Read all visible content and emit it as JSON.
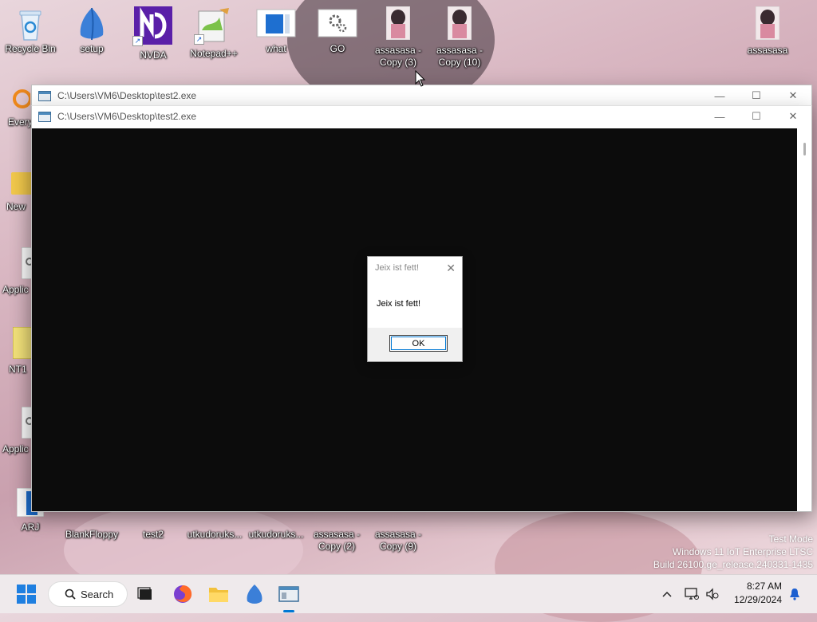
{
  "desktop": {
    "icons_top": [
      {
        "label": "Recycle Bin"
      },
      {
        "label": "setup"
      },
      {
        "label": "NVDA"
      },
      {
        "label": "Notepad++"
      },
      {
        "label": "what"
      },
      {
        "label": "GO"
      },
      {
        "label": "assasasa - Copy (3)"
      },
      {
        "label": "assasasa - Copy (10)"
      },
      {
        "label": "assasasa"
      }
    ],
    "icons_left": [
      {
        "label": "Every"
      },
      {
        "label": "New"
      },
      {
        "label": "Applic"
      },
      {
        "label": "NT1"
      },
      {
        "label": "Applic"
      }
    ],
    "icons_bottom": [
      {
        "label": "ARJ"
      },
      {
        "label": "BlankFloppy"
      },
      {
        "label": "test2"
      },
      {
        "label": "utkudoruks..."
      },
      {
        "label": "utkudoruks..."
      },
      {
        "label": "assasasa - Copy (2)"
      },
      {
        "label": "assasasa - Copy (9)"
      }
    ]
  },
  "windows": {
    "back_title": "C:\\Users\\VM6\\Desktop\\test2.exe",
    "front_title": "C:\\Users\\VM6\\Desktop\\test2.exe",
    "minimize_glyph": "—",
    "maximize_glyph": "☐",
    "close_glyph": "✕"
  },
  "dialog": {
    "title": "Jeix ist fett!",
    "message": "Jeix ist fett!",
    "ok_label": "OK",
    "close_glyph": "✕"
  },
  "watermark": {
    "line1": "Test Mode",
    "line2": "Windows 11 IoT Enterprise LTSC",
    "line3": "Build 26100.ge_release.240331-1435"
  },
  "taskbar": {
    "search_label": "Search",
    "time": "8:27 AM",
    "date": "12/29/2024",
    "chevron": "^"
  },
  "colors": {
    "console_bg": "#0c0c0c",
    "accent": "#0078d4",
    "taskbar_bg": "#efeaec"
  }
}
